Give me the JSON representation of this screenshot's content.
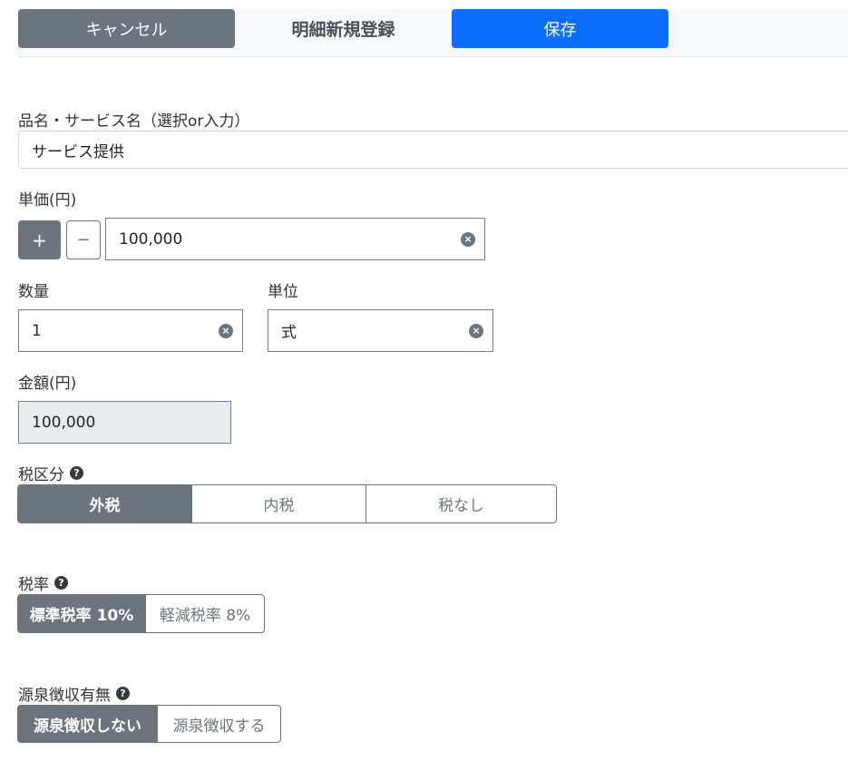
{
  "header": {
    "cancel_label": "キャンセル",
    "title": "明細新規登録",
    "save_label": "保存"
  },
  "item_name": {
    "label": "品名・サービス名（選択or入力）",
    "value": "サービス提供"
  },
  "unit_price": {
    "label": "単価(円)",
    "plus_label": "+",
    "minus_label": "−",
    "value": "100,000"
  },
  "quantity": {
    "label": "数量",
    "value": "1"
  },
  "unit": {
    "label": "単位",
    "value": "式"
  },
  "amount": {
    "label": "金額(円)",
    "value": "100,000"
  },
  "tax_category": {
    "label": "税区分",
    "options": [
      "外税",
      "内税",
      "税なし"
    ],
    "selected": "外税"
  },
  "tax_rate": {
    "label": "税率",
    "options": [
      "標準税率 10%",
      "軽減税率 8%"
    ],
    "selected": "標準税率 10%"
  },
  "withholding": {
    "label": "源泉徴収有無",
    "options": [
      "源泉徴収しない",
      "源泉徴収する"
    ],
    "selected": "源泉徴収しない"
  },
  "icons": {
    "help": "?",
    "clear": "×"
  },
  "colors": {
    "primary": "#0d6efd",
    "secondary": "#6c757d",
    "readonly_bg": "#e9ecef"
  }
}
